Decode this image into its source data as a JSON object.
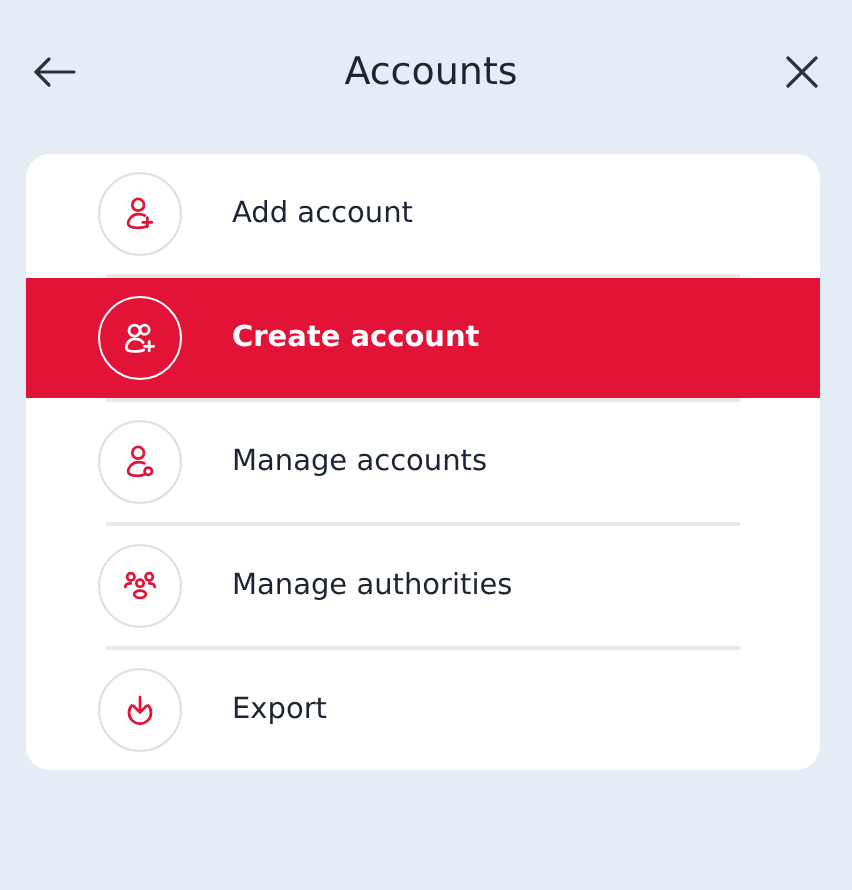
{
  "header": {
    "title": "Accounts"
  },
  "menu": [
    {
      "label": "Add account",
      "selected": false
    },
    {
      "label": "Create account",
      "selected": true
    },
    {
      "label": "Manage accounts",
      "selected": false
    },
    {
      "label": "Manage authorities",
      "selected": false
    },
    {
      "label": "Export",
      "selected": false
    }
  ]
}
